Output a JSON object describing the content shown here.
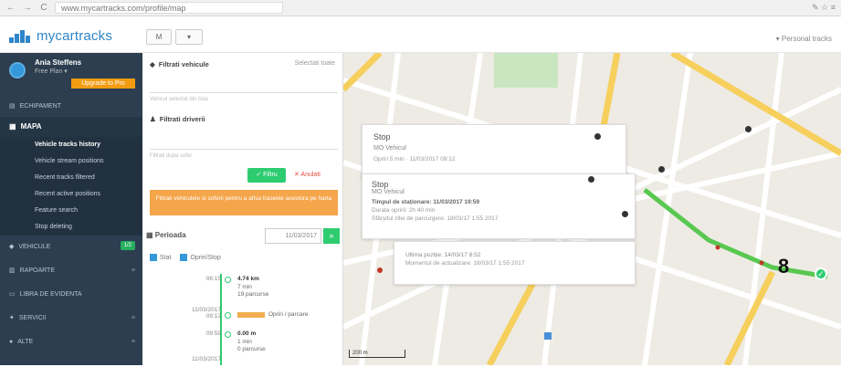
{
  "browser": {
    "url": "www.mycartracks.com/profile/map",
    "back": "←",
    "forward": "→",
    "reload": "C"
  },
  "header": {
    "logo": "mycartracks",
    "btn1": "M",
    "btn2": "▾",
    "right": "▾ Personal tracks"
  },
  "user": {
    "name": "Ania Steffens",
    "role": "Free Plan ▾",
    "badge": "Upgrade to Pro"
  },
  "sidebar": {
    "home": "ECHIPAMENT",
    "map_head": "MAPA",
    "subs": [
      "Vehicle tracks history",
      "Vehicle stream positions",
      "Recent tracks filtered",
      "Recent active positions",
      "Feature search",
      "Stop deleting"
    ],
    "groups": [
      {
        "label": "VEHICULE",
        "badge": "1/2",
        "count": ""
      },
      {
        "label": "RAPOARTE",
        "badge": "",
        "count": "≡"
      },
      {
        "label": "LIBRA DE EVIDENTA",
        "badge": "",
        "count": ""
      },
      {
        "label": "SERVICII",
        "badge": "",
        "count": "≡"
      },
      {
        "label": "ALTE",
        "badge": "",
        "count": "≡"
      }
    ]
  },
  "panel": {
    "filter_vehicles": "Filtrati vehicule",
    "filter_link": "Selectati toate",
    "vehicle_hint": "Vehicul selectat din lista",
    "filter_drivers": "Filtrati driverii",
    "driver_hint": "Filtrati dupa sofer",
    "btn_filter": "✓ Filtru",
    "btn_reset": "✕ Anulati",
    "notice": "Filtrati vehiculele si soferii pentru a afisa traseele acestora pe harta",
    "date_label": "Perioada",
    "date_value": "11/03/2017",
    "date_go": "»",
    "chk1": "Stat",
    "chk2": "Opriri/Stop",
    "timeline": [
      {
        "time": "06:15",
        "dist": "4.74 km",
        "dur": "7 min",
        "extra": "19 parcurse"
      },
      {
        "time": "11/03/2017 09:12",
        "dist": "",
        "dur": "",
        "extra": "Opriri / parcare"
      },
      {
        "time": "09:59",
        "dist": "0.00 m",
        "dur": "1 min",
        "extra": "0 parcurse"
      },
      {
        "time": "11/03/2017",
        "dist": "",
        "dur": "",
        "extra": ""
      }
    ]
  },
  "map": {
    "popup1_title": "Stop",
    "popup1_sub": "MO Vehicul",
    "popup1_line": "Opriri 5 min · 11/03/2017 09:12",
    "popup2_title": "Stop",
    "popup2_sub": "MO Vehicul",
    "popup2_l1": "Timpul de staționare: 11/03/2017 19:59",
    "popup2_l2": "Durata opririi: 2h 40 min",
    "popup2_l3": "Sfârșitul zilei de parcurgere: 18/03/17 1:55 2017",
    "popup3_l1": "Ultima poziție: 14/03/17 8:52",
    "popup3_l2": "Momentul de actualizare: 18/03/17 1:55 2017",
    "marker": "8",
    "pin": "✓",
    "scale": "200 m"
  },
  "colors": {
    "sidebar": "#2c3e50",
    "accent": "#2e86c9",
    "green": "#2ecc71",
    "orange": "#f5a54a"
  }
}
